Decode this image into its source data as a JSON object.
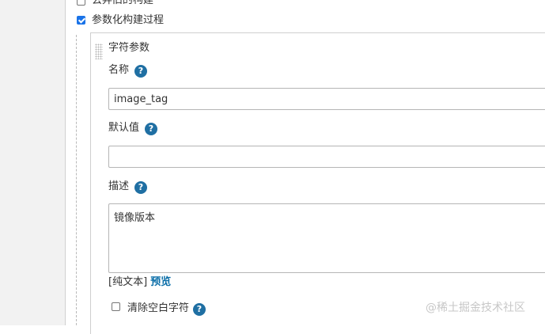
{
  "options": {
    "discard_old_builds": {
      "label": "丢弃旧的构建",
      "checked": false
    },
    "parameterized": {
      "label": "参数化构建过程",
      "checked": true
    }
  },
  "param": {
    "type_label": "字符参数",
    "name_label": "名称",
    "name_value": "image_tag",
    "default_label": "默认值",
    "default_value": "",
    "description_label": "描述",
    "description_value": "镜像版本",
    "format_prefix": "[纯文本]",
    "preview_link": "预览",
    "trim": {
      "label": "清除空白字符",
      "checked": false
    },
    "help_icon_glyph": "?"
  },
  "watermark": "@稀土掘金技术社区",
  "colors": {
    "help": "#1f6fa3",
    "link": "#0b6ea8",
    "checkbox_checked": "#1a73e8"
  }
}
